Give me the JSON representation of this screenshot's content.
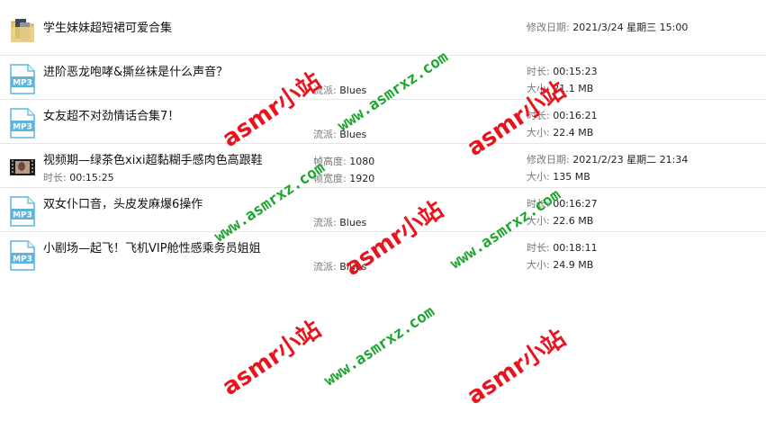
{
  "colors": {
    "watermark_red": "#e8141e",
    "watermark_green": "#1aa52c",
    "mp3_icon": "#5fb4de"
  },
  "rows": [
    {
      "icon": "folder-icon",
      "name": "学生妹妹超短裙可爱合集",
      "right1_key": "修改日期:",
      "right1_val": "2021/3/24 星期三 15:00"
    },
    {
      "icon": "mp3-file-icon",
      "name": "进阶恶龙咆哮&撕丝袜是什么声音？",
      "mid2_key": "流派:",
      "mid2_val": "Blues",
      "right1_key": "时长:",
      "right1_val": "00:15:23",
      "right2_key": "大小:",
      "right2_val": "21.1 MB"
    },
    {
      "icon": "mp3-file-icon",
      "name": "女友超不对劲情话合集7！",
      "mid2_key": "流派:",
      "mid2_val": "Blues",
      "right1_key": "时长:",
      "right1_val": "00:16:21",
      "right2_key": "大小:",
      "right2_val": "22.4 MB"
    },
    {
      "icon": "video-file-icon",
      "name": "视频期—绿茶色xixi超黏糊手感肉色高跟鞋",
      "sub_key": "时长:",
      "sub_val": "00:15:25",
      "mid1_key": "帧高度:",
      "mid1_val": "1080",
      "mid2_key": "帧宽度:",
      "mid2_val": "1920",
      "right1_key": "修改日期:",
      "right1_val": "2021/2/23 星期二 21:34",
      "right2_key": "大小:",
      "right2_val": "135 MB"
    },
    {
      "icon": "mp3-file-icon",
      "name": "双女仆口音，头皮发麻爆6操作",
      "mid2_key": "流派:",
      "mid2_val": "Blues",
      "right1_key": "时长:",
      "right1_val": "00:16:27",
      "right2_key": "大小:",
      "right2_val": "22.6 MB"
    },
    {
      "icon": "mp3-file-icon",
      "name": "小剧场—起飞！飞机VIP舱性感乘务员姐姐",
      "mid2_key": "流派:",
      "mid2_val": "Blues",
      "right1_key": "时长:",
      "right1_val": "00:18:11",
      "right2_key": "大小:",
      "right2_val": "24.9 MB"
    }
  ],
  "watermarks": {
    "red": "asmr小站",
    "green": "www.asmrxz.com"
  }
}
